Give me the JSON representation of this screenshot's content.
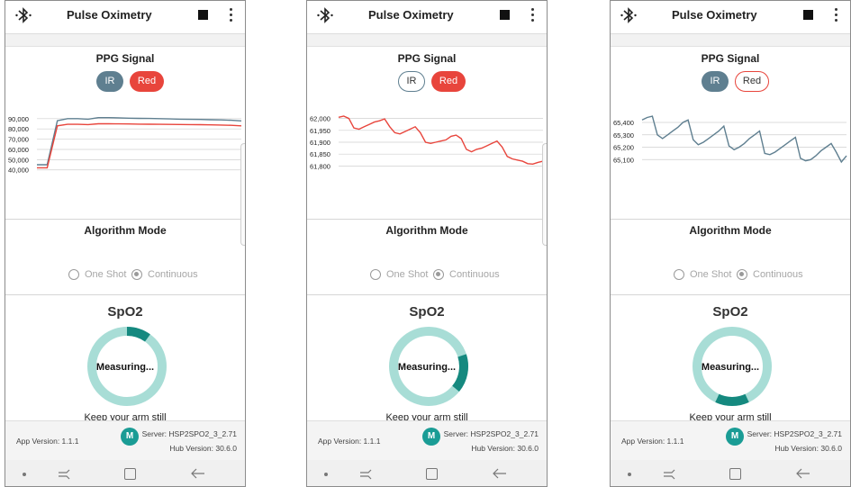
{
  "header": {
    "title": "Pulse Oximetry",
    "bluetooth_icon": "bluetooth-icon",
    "stop_icon": "stop-icon",
    "menu_icon": "more-vert-icon"
  },
  "ppg": {
    "title": "PPG Signal",
    "ir_label": "IR",
    "red_label": "Red"
  },
  "algorithm": {
    "title": "Algorithm Mode",
    "one_shot_label": "One Shot",
    "continuous_label": "Continuous",
    "selected": "Continuous"
  },
  "spo2": {
    "title": "SpO2",
    "status": "Measuring...",
    "hint": "Keep your arm still"
  },
  "footer": {
    "app_version": "App Version: 1.1.1",
    "server": "Server: HSP2SPO2_3_2.71",
    "hub_version": "Hub Version: 30.6.0",
    "logo_text": "M"
  },
  "colors": {
    "ir": "#5f7f90",
    "red": "#e8453c",
    "ring_track": "#a8ddd6",
    "ring_fill": "#15897f"
  },
  "screens": [
    {
      "ir_active": true,
      "red_active": true,
      "ring_arc": {
        "start": 0.0,
        "end": 0.1
      },
      "chart_data": {
        "type": "line",
        "yticks": [
          "90,000",
          "80,000",
          "70,000",
          "60,000",
          "50,000",
          "40,000"
        ],
        "ylim": [
          38000,
          96000
        ],
        "x": [
          0,
          1,
          2,
          3,
          4,
          5,
          6,
          7,
          8,
          9,
          10,
          11,
          12,
          13,
          14,
          15,
          16,
          17,
          18,
          19,
          20
        ],
        "series": [
          {
            "color": "#5f7f90",
            "values": [
              45000,
              45000,
              88000,
              90000,
              90000,
              89500,
              91000,
              91000,
              90800,
              90500,
              90300,
              90200,
              90000,
              89800,
              89500,
              89300,
              89200,
              89000,
              88800,
              88400,
              87800
            ]
          },
          {
            "color": "#e8453c",
            "values": [
              42000,
              42000,
              83000,
              84500,
              84500,
              84200,
              85000,
              85000,
              84900,
              84800,
              84700,
              84600,
              84500,
              84400,
              84300,
              84200,
              84100,
              84000,
              83800,
              83500,
              83000
            ]
          }
        ]
      }
    },
    {
      "ir_active": false,
      "red_active": true,
      "ring_arc": {
        "start": 0.2,
        "end": 0.36
      },
      "chart_data": {
        "type": "line",
        "yticks": [
          "62,000",
          "61,950",
          "61,900",
          "61,850",
          "61,800"
        ],
        "ylim": [
          61775,
          62025
        ],
        "x": [
          0,
          1,
          2,
          3,
          4,
          5,
          6,
          7,
          8,
          9,
          10,
          11,
          12,
          13,
          14,
          15,
          16,
          17,
          18,
          19,
          20,
          21,
          22,
          23,
          24,
          25,
          26,
          27,
          28,
          29,
          30,
          31,
          32,
          33,
          34,
          35,
          36,
          37,
          38,
          39,
          40
        ],
        "series": [
          {
            "color": "#e8453c",
            "values": [
              62005,
              62010,
              62000,
              61960,
              61955,
              61965,
              61975,
              61985,
              61990,
              61998,
              61965,
              61940,
              61935,
              61945,
              61955,
              61965,
              61940,
              61900,
              61895,
              61900,
              61905,
              61910,
              61925,
              61930,
              61915,
              61870,
              61860,
              61870,
              61875,
              61885,
              61895,
              61905,
              61880,
              61840,
              61830,
              61825,
              61820,
              61810,
              61808,
              61815,
              61820
            ]
          }
        ]
      }
    },
    {
      "ir_active": true,
      "red_active": false,
      "ring_arc": {
        "start": 0.43,
        "end": 0.57
      },
      "chart_data": {
        "type": "line",
        "yticks": [
          "65,400",
          "65,300",
          "65,200",
          "65,100"
        ],
        "ylim": [
          65000,
          65480
        ],
        "x": [
          0,
          1,
          2,
          3,
          4,
          5,
          6,
          7,
          8,
          9,
          10,
          11,
          12,
          13,
          14,
          15,
          16,
          17,
          18,
          19,
          20,
          21,
          22,
          23,
          24,
          25,
          26,
          27,
          28,
          29,
          30,
          31,
          32,
          33,
          34,
          35,
          36,
          37,
          38,
          39,
          40
        ],
        "series": [
          {
            "color": "#5f7f90",
            "values": [
              65420,
              65440,
              65450,
              65300,
              65270,
              65300,
              65330,
              65360,
              65400,
              65420,
              65260,
              65220,
              65240,
              65270,
              65300,
              65330,
              65370,
              65210,
              65180,
              65200,
              65230,
              65270,
              65300,
              65330,
              65150,
              65140,
              65160,
              65190,
              65220,
              65250,
              65280,
              65110,
              65090,
              65100,
              65130,
              65170,
              65200,
              65230,
              65160,
              65080,
              65130
            ]
          }
        ]
      }
    }
  ]
}
